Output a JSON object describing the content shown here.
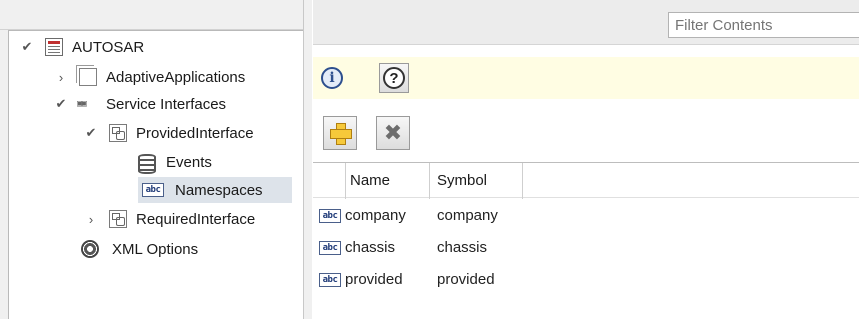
{
  "tree": {
    "root": {
      "label": "AUTOSAR",
      "expanded": true
    },
    "items": [
      {
        "label": "AdaptiveApplications",
        "expanded": false
      },
      {
        "label": "Service Interfaces",
        "expanded": true
      },
      {
        "label": "ProvidedInterface",
        "expanded": true
      },
      {
        "label": "Events"
      },
      {
        "label": "Namespaces",
        "selected": true
      },
      {
        "label": "RequiredInterface",
        "expanded": false
      },
      {
        "label": "XML Options"
      }
    ]
  },
  "filter": {
    "placeholder": "Filter Contents"
  },
  "toolbar": {
    "info_icon": "info-icon",
    "help_icon": "help-icon",
    "add_icon": "add-icon",
    "delete_icon": "delete-icon"
  },
  "table": {
    "columns": [
      "Name",
      "Symbol"
    ],
    "rows": [
      {
        "name": "company",
        "symbol": "company"
      },
      {
        "name": "chassis",
        "symbol": "chassis"
      },
      {
        "name": "provided",
        "symbol": "provided"
      }
    ],
    "icon_text": "abc"
  },
  "colors": {
    "help_bar_bg": "#fffde3",
    "selection_bg": "#dde3ea",
    "add_icon": "#f6c93a"
  }
}
